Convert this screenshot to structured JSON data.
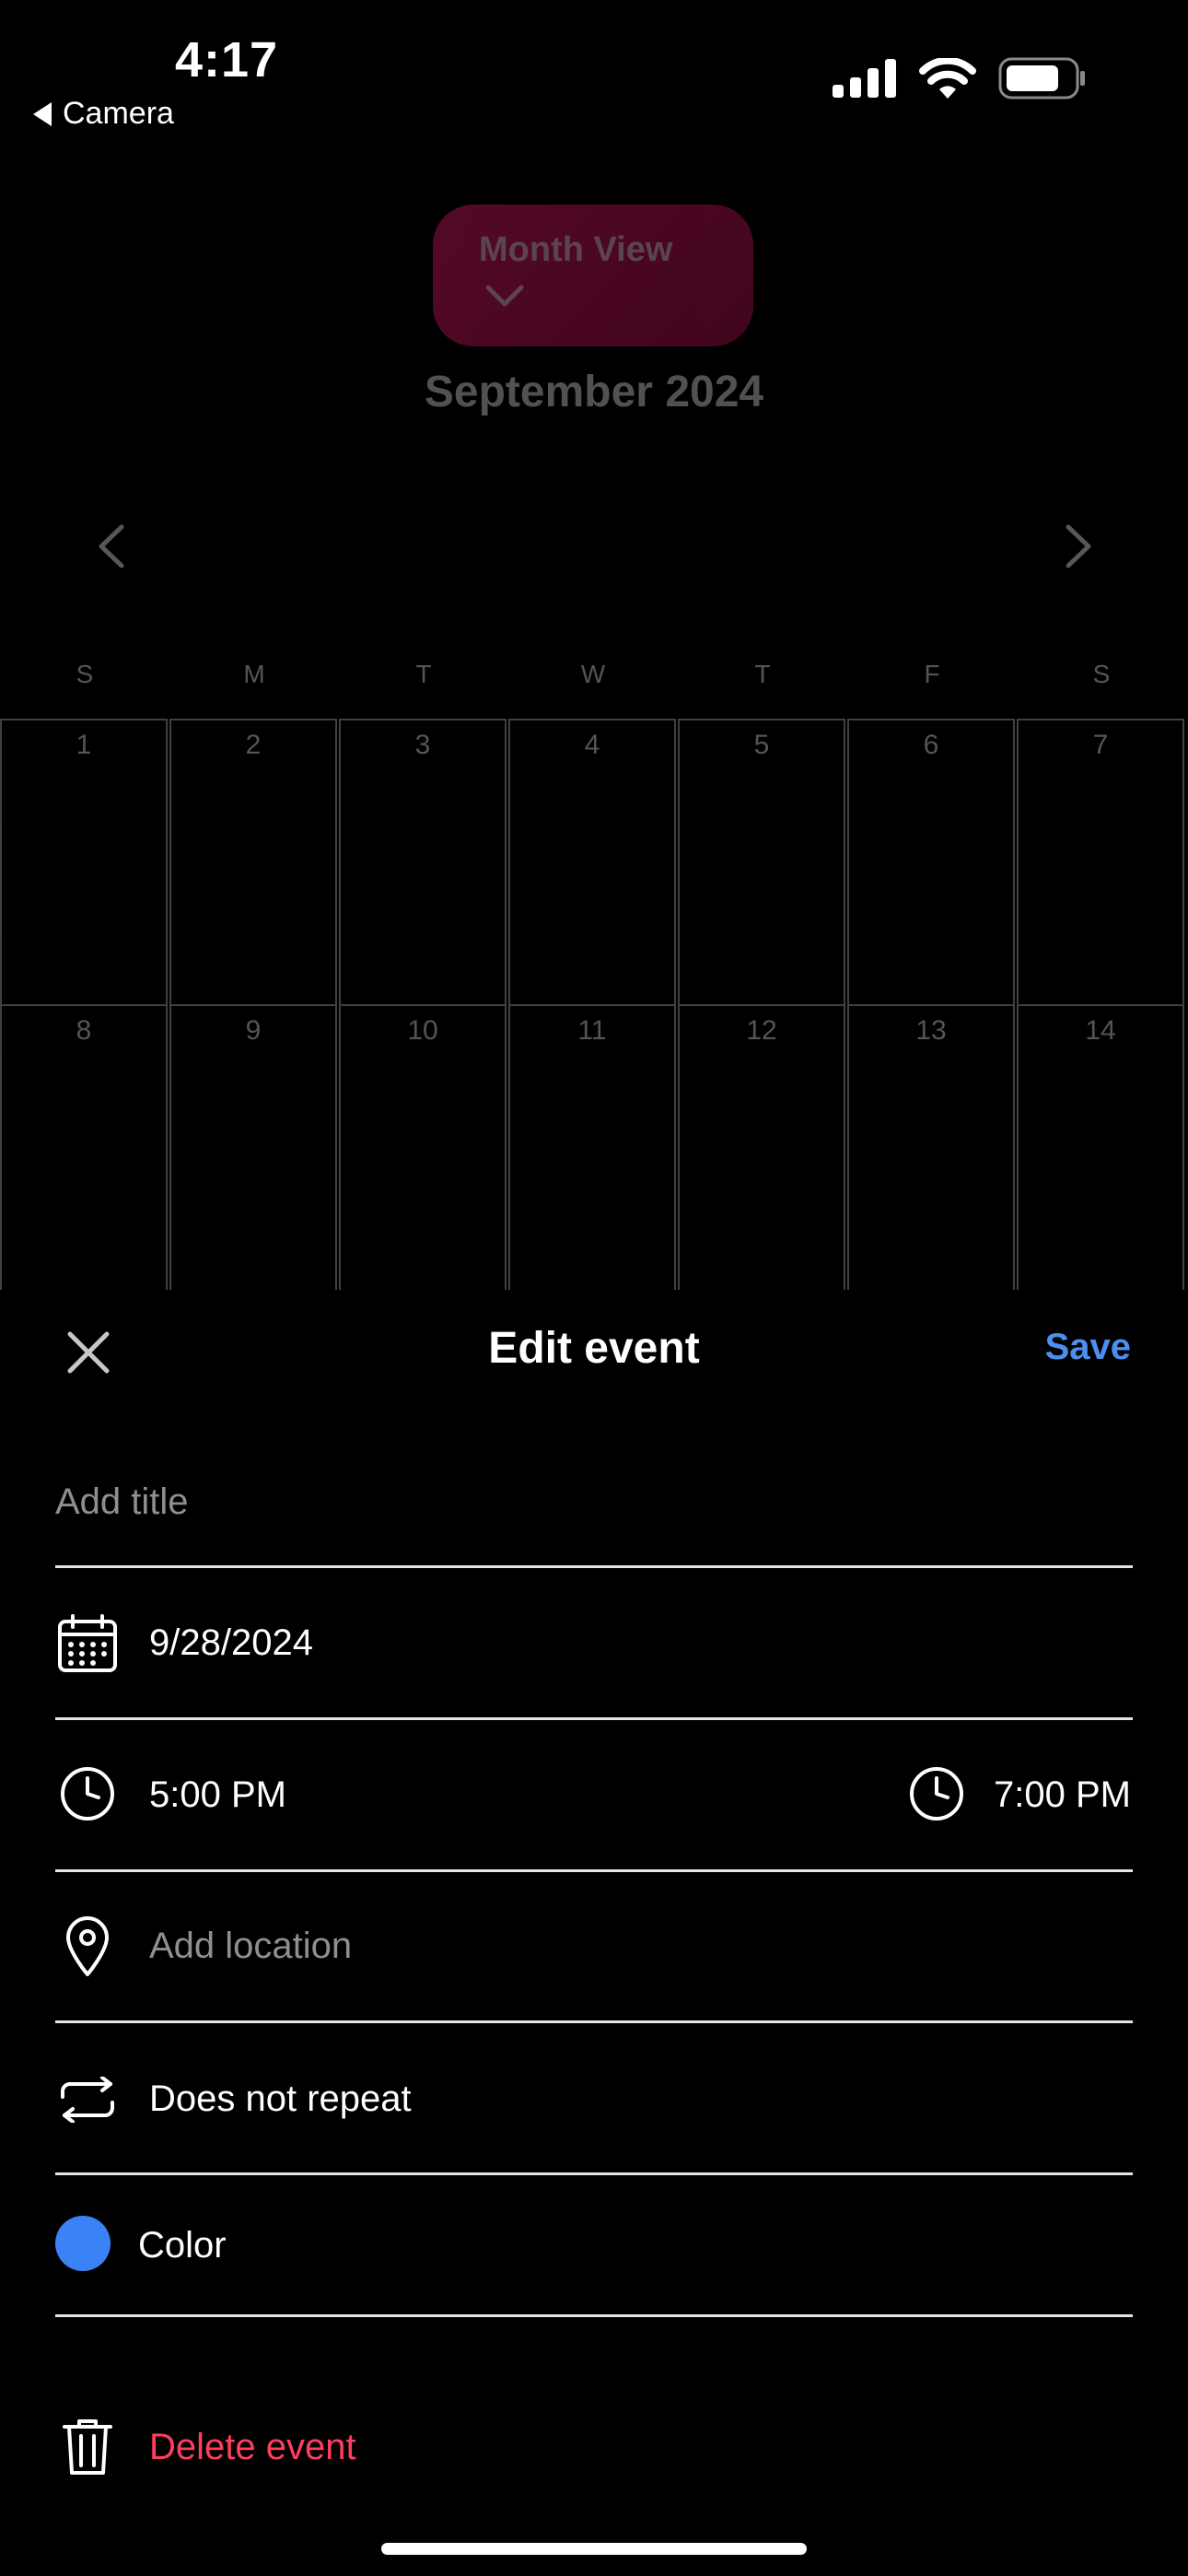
{
  "status_bar": {
    "time": "4:17",
    "back_label": "Camera"
  },
  "calendar": {
    "view_label": "Month View",
    "month_title": "September 2024",
    "weekdays": [
      "S",
      "M",
      "T",
      "W",
      "T",
      "F",
      "S"
    ],
    "weeks": [
      [
        "1",
        "2",
        "3",
        "4",
        "5",
        "6",
        "7"
      ],
      [
        "8",
        "9",
        "10",
        "11",
        "12",
        "13",
        "14"
      ]
    ],
    "accent_color": "#c7165f"
  },
  "sheet": {
    "title": "Edit event",
    "save_label": "Save",
    "title_placeholder": "Add title",
    "date": "9/28/2024",
    "start_time": "5:00 PM",
    "end_time": "7:00 PM",
    "location_placeholder": "Add location",
    "repeat": "Does not repeat",
    "color_label": "Color",
    "color_value": "#3b82f6",
    "delete_label": "Delete event"
  }
}
